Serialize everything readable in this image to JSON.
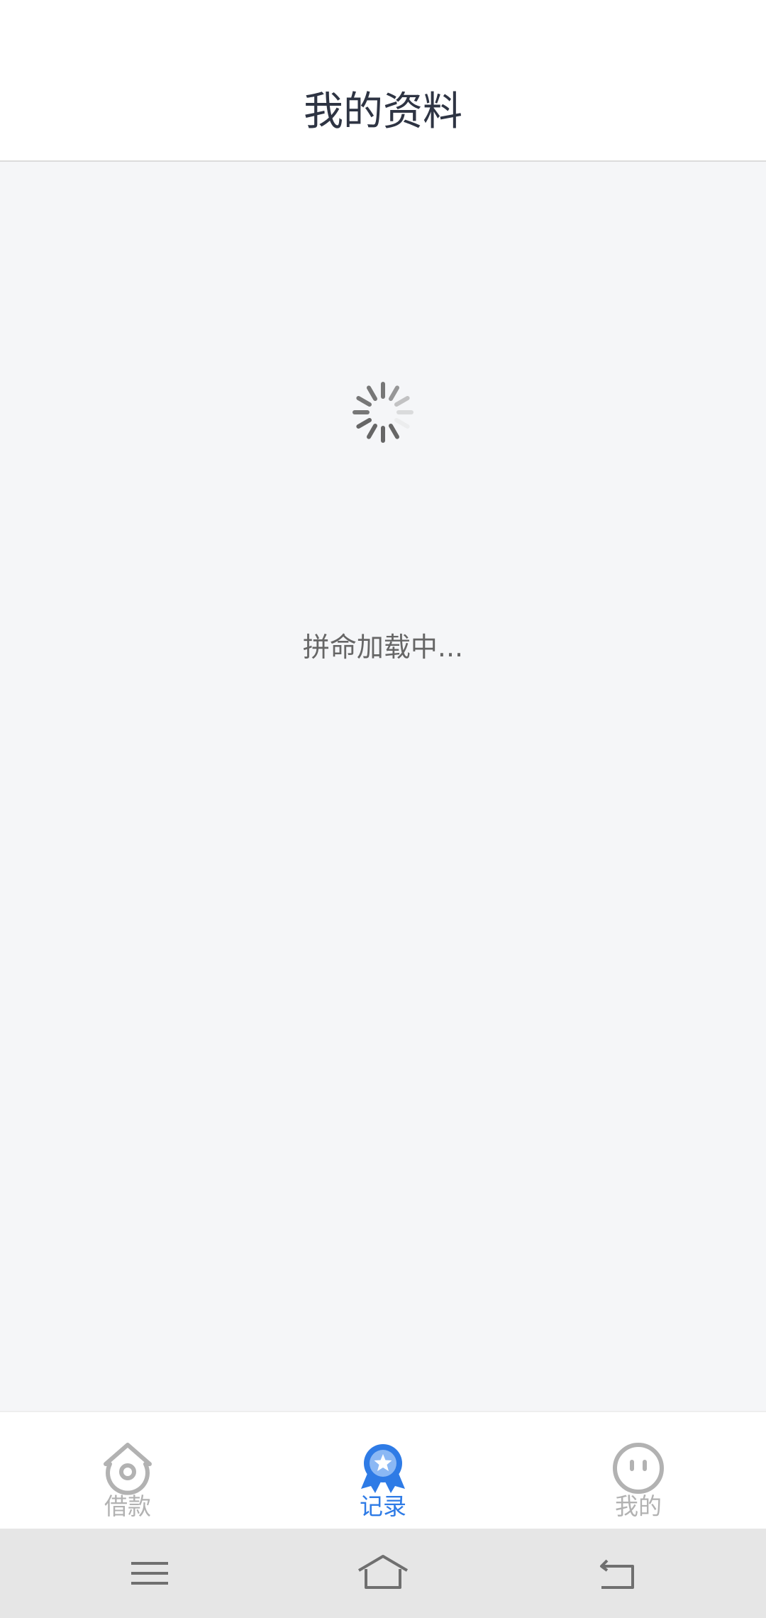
{
  "header": {
    "title": "我的资料"
  },
  "loading": {
    "text": "拼命加载中..."
  },
  "tabbar": {
    "active_color": "#2e7be6",
    "inactive_color": "#b2b2b2",
    "items": [
      {
        "label": "借款",
        "icon": "loan-home-icon",
        "active": false
      },
      {
        "label": "记录",
        "icon": "record-badge-icon",
        "active": true
      },
      {
        "label": "我的",
        "icon": "face-profile-icon",
        "active": false
      }
    ]
  },
  "system_nav": {
    "buttons": [
      "menu-icon",
      "home-icon",
      "back-icon"
    ]
  }
}
